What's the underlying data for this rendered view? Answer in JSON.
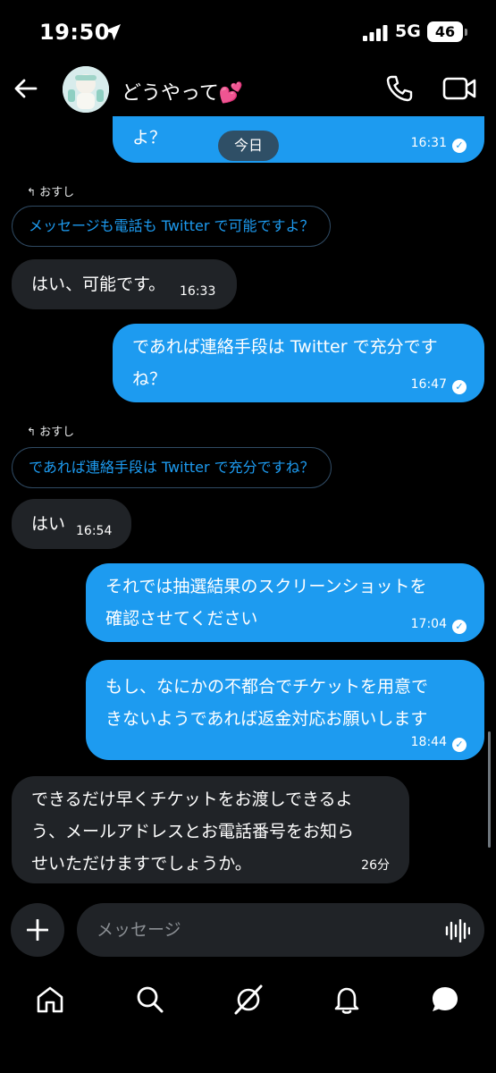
{
  "status_bar": {
    "time": "19:50",
    "network": "5G",
    "battery": "46"
  },
  "header": {
    "title": "どうやって💕",
    "back_icon": "arrow-left-icon",
    "phone_icon": "phone-icon",
    "video_icon": "video-camera-icon"
  },
  "messages": {
    "date_divider": "今日",
    "items": [
      {
        "dir": "out",
        "text": "よ？",
        "time": "16:31"
      },
      {
        "dir": "in",
        "reply_label": "おすし",
        "quote": "メッセージも電話も Twitter で可能ですよ？",
        "text": "はい、可能です。",
        "time": "16:33"
      },
      {
        "dir": "out",
        "text": "であれば連絡手段は Twitter で充分です\nね？",
        "time": "16:47"
      },
      {
        "dir": "in",
        "reply_label": "おすし",
        "quote": "であれば連絡手段は Twitter で充分ですね？",
        "text": "はい",
        "time": "16:54"
      },
      {
        "dir": "out",
        "text": "それでは抽選結果のスクリーンショットを\n確認させてください",
        "time": "17:04"
      },
      {
        "dir": "out",
        "text": "もし、なにかの不都合でチケットを用意で\nきないようであれば返金対応お願いします",
        "time": "18:44"
      },
      {
        "dir": "in",
        "text": "できるだけ早くチケットをお渡しできるよ\nう、メールアドレスとお電話番号をお知ら\nせいただけますでしょうか。",
        "time": "26分"
      }
    ]
  },
  "composer": {
    "placeholder": "メッセージ"
  },
  "nav": {
    "items": [
      "home-icon",
      "search-icon",
      "grok-icon",
      "notifications-icon",
      "messages-icon"
    ]
  },
  "colors": {
    "accent": "#1d9bf0",
    "incoming_bubble": "#202327",
    "background": "#000000"
  }
}
